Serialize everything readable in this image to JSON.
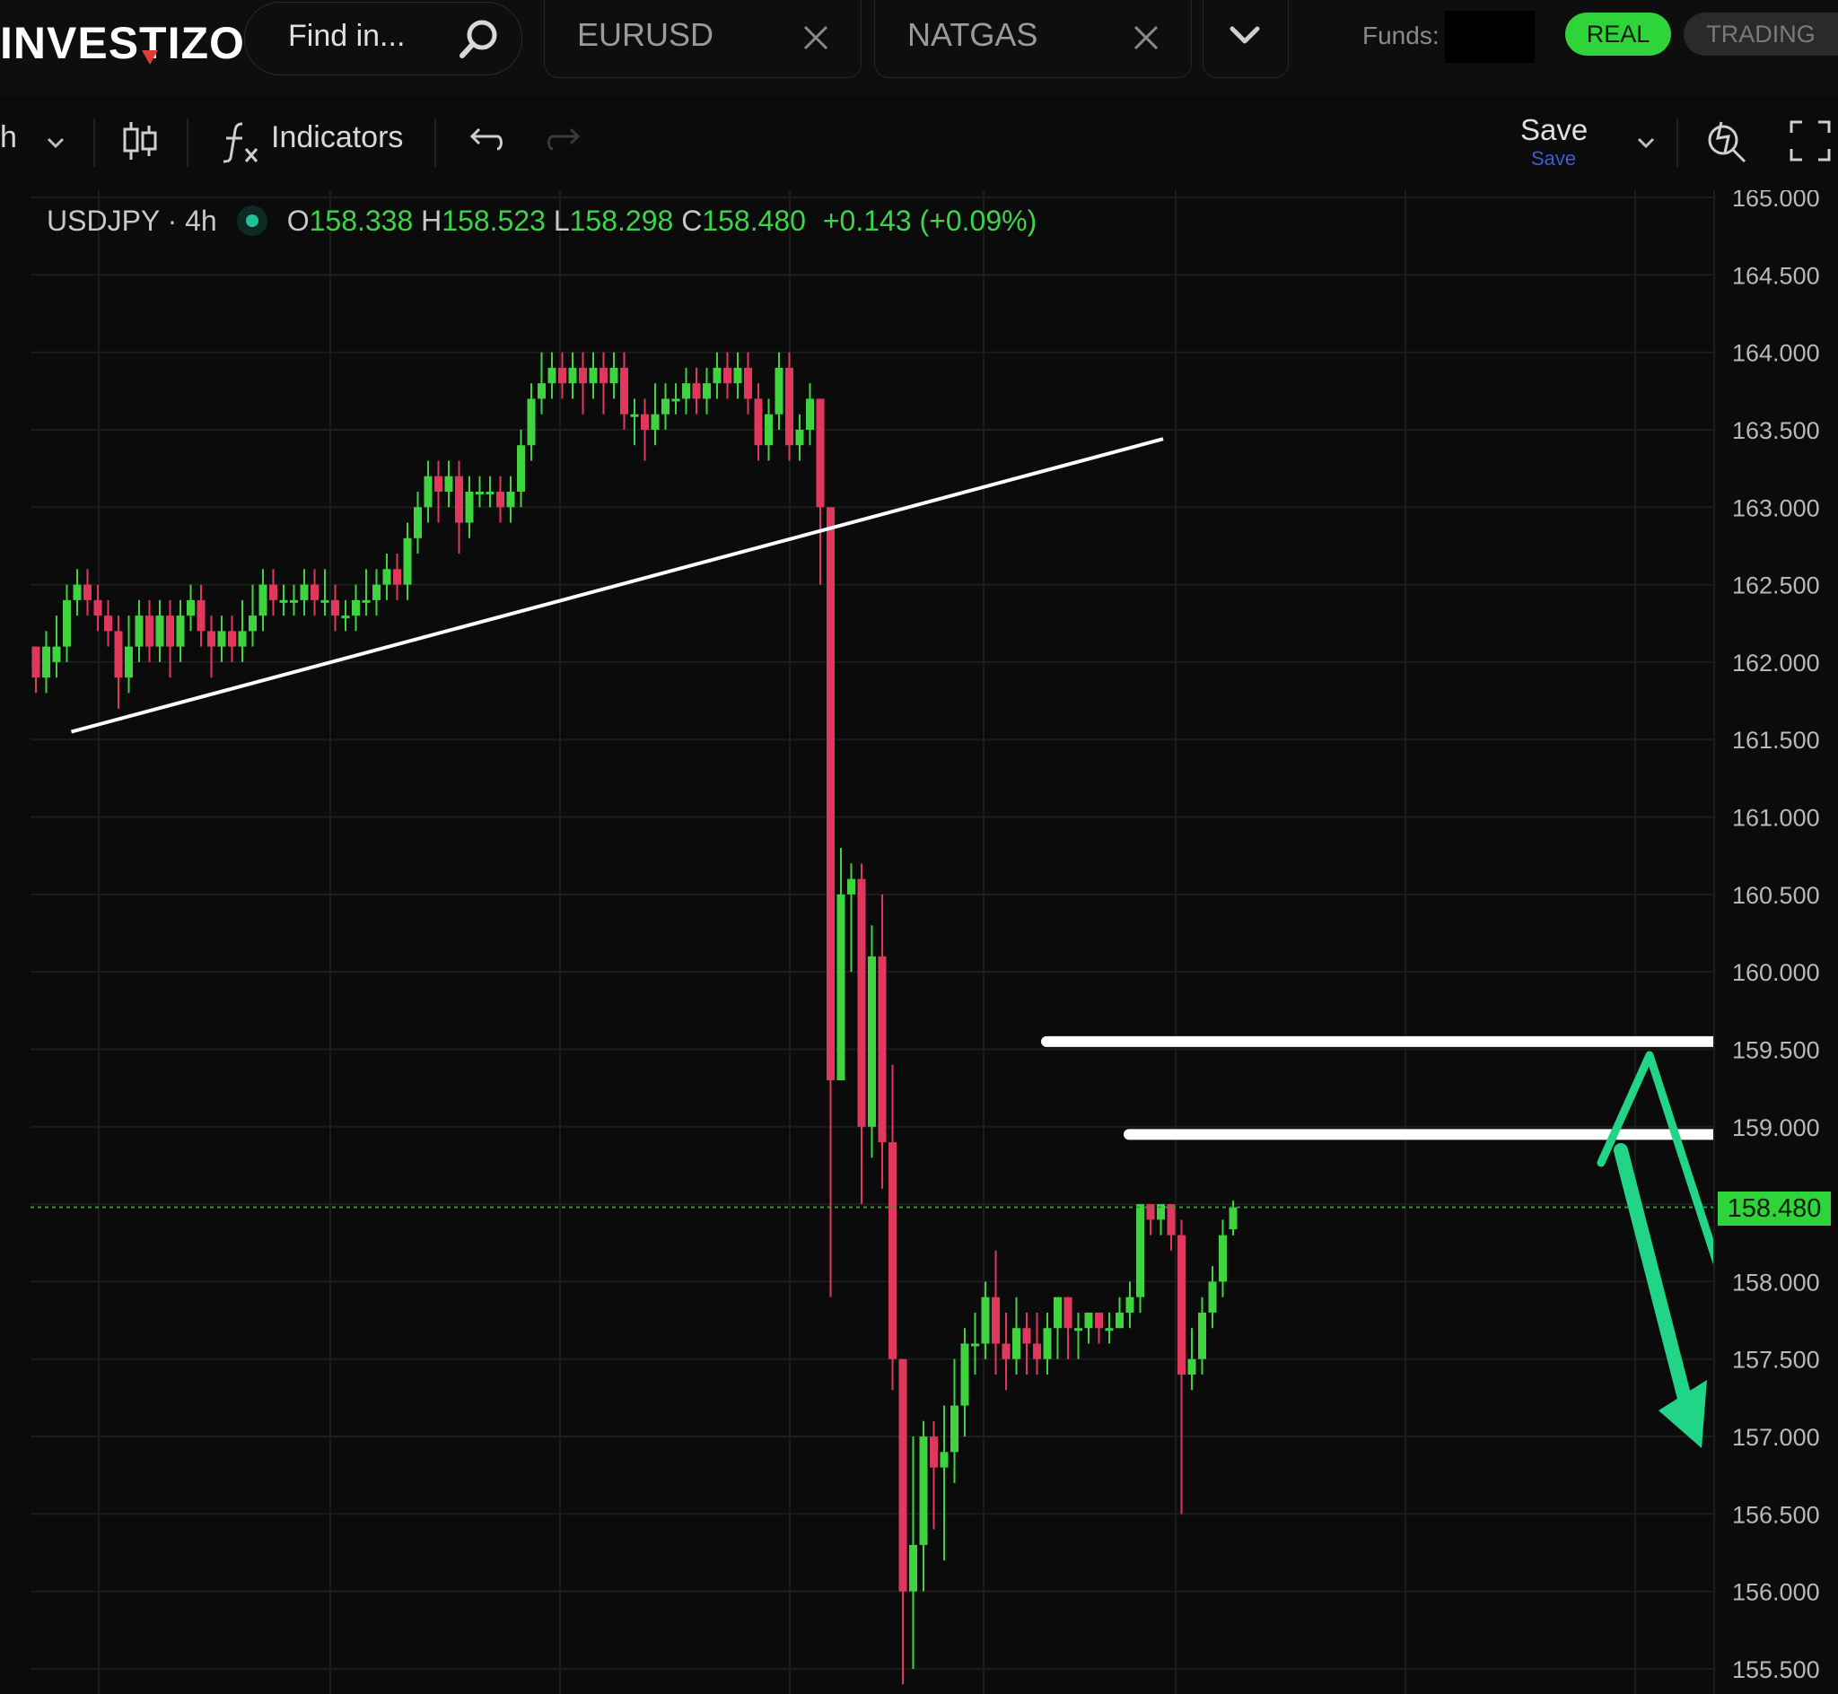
{
  "app": {
    "logo_text": "INVESTIZO",
    "search_placeholder": "Find in...",
    "tabs": [
      {
        "label": "EURUSD"
      },
      {
        "label": "NATGAS"
      }
    ],
    "funds_label": "Funds:",
    "mode_buttons": {
      "real": "REAL",
      "trading": "TRADING"
    }
  },
  "toolbar": {
    "interval_label": "h",
    "indicators_label": "Indicators",
    "save_label": "Save",
    "save_sublabel": "Save"
  },
  "legend": {
    "symbol": "USDJPY · 4h",
    "o_key": "O",
    "o_val": "158.338",
    "h_key": "H",
    "h_val": "158.523",
    "l_key": "L",
    "l_val": "158.298",
    "c_key": "C",
    "c_val": "158.480",
    "change": "+0.143 (+0.09%)"
  },
  "colors": {
    "up": "#3ed33f",
    "down": "#e0385c",
    "accent": "#2fd33a",
    "arrow": "#22d486",
    "grid": "#1c1c1c",
    "background": "#0b0b0b"
  },
  "chart_data": {
    "type": "candlestick",
    "symbol": "USDJPY",
    "timeframe": "4h",
    "ylim": [
      155.5,
      165.0
    ],
    "y_ticks": [
      "165.000",
      "164.500",
      "164.000",
      "163.500",
      "163.000",
      "162.500",
      "162.000",
      "161.500",
      "161.000",
      "160.500",
      "160.000",
      "159.500",
      "159.000",
      "158.500",
      "158.000",
      "157.500",
      "157.000",
      "156.500",
      "156.000",
      "155.500"
    ],
    "y_tick_values": [
      165.0,
      164.5,
      164.0,
      163.5,
      163.0,
      162.5,
      162.0,
      161.5,
      161.0,
      160.5,
      160.0,
      159.5,
      159.0,
      158.5,
      158.0,
      157.5,
      157.0,
      156.5,
      156.0,
      155.5
    ],
    "last_price": "158.480",
    "last_price_value": 158.48,
    "candles": [
      [
        162.1,
        161.9,
        162.1,
        161.8
      ],
      [
        161.9,
        162.1,
        162.2,
        161.8
      ],
      [
        162.0,
        162.1,
        162.3,
        161.9
      ],
      [
        162.1,
        162.4,
        162.5,
        162.0
      ],
      [
        162.4,
        162.5,
        162.6,
        162.3
      ],
      [
        162.5,
        162.4,
        162.6,
        162.3
      ],
      [
        162.4,
        162.3,
        162.5,
        162.2
      ],
      [
        162.3,
        162.2,
        162.4,
        162.1
      ],
      [
        162.2,
        161.9,
        162.3,
        161.7
      ],
      [
        161.9,
        162.1,
        162.3,
        161.8
      ],
      [
        162.1,
        162.3,
        162.4,
        162.0
      ],
      [
        162.3,
        162.1,
        162.4,
        162.0
      ],
      [
        162.1,
        162.3,
        162.4,
        162.0
      ],
      [
        162.3,
        162.1,
        162.4,
        161.9
      ],
      [
        162.1,
        162.3,
        162.4,
        162.0
      ],
      [
        162.3,
        162.4,
        162.5,
        162.2
      ],
      [
        162.4,
        162.2,
        162.5,
        162.1
      ],
      [
        162.2,
        162.1,
        162.3,
        161.9
      ],
      [
        162.1,
        162.2,
        162.3,
        162.0
      ],
      [
        162.2,
        162.1,
        162.3,
        162.0
      ],
      [
        162.1,
        162.2,
        162.4,
        162.0
      ],
      [
        162.2,
        162.3,
        162.5,
        162.1
      ],
      [
        162.3,
        162.5,
        162.6,
        162.2
      ],
      [
        162.5,
        162.4,
        162.6,
        162.3
      ],
      [
        162.4,
        162.4,
        162.5,
        162.3
      ],
      [
        162.4,
        162.4,
        162.5,
        162.3
      ],
      [
        162.4,
        162.5,
        162.6,
        162.3
      ],
      [
        162.5,
        162.4,
        162.6,
        162.3
      ],
      [
        162.4,
        162.4,
        162.6,
        162.3
      ],
      [
        162.4,
        162.3,
        162.5,
        162.2
      ],
      [
        162.3,
        162.3,
        162.4,
        162.2
      ],
      [
        162.3,
        162.4,
        162.5,
        162.2
      ],
      [
        162.4,
        162.4,
        162.6,
        162.3
      ],
      [
        162.4,
        162.5,
        162.6,
        162.3
      ],
      [
        162.5,
        162.6,
        162.7,
        162.4
      ],
      [
        162.6,
        162.5,
        162.7,
        162.4
      ],
      [
        162.5,
        162.8,
        162.9,
        162.4
      ],
      [
        162.8,
        163.0,
        163.1,
        162.7
      ],
      [
        163.0,
        163.2,
        163.3,
        162.9
      ],
      [
        163.2,
        163.1,
        163.3,
        162.9
      ],
      [
        163.1,
        163.2,
        163.3,
        163.0
      ],
      [
        163.2,
        162.9,
        163.3,
        162.7
      ],
      [
        162.9,
        163.1,
        163.2,
        162.8
      ],
      [
        163.1,
        163.1,
        163.2,
        163.0
      ],
      [
        163.1,
        163.1,
        163.2,
        163.0
      ],
      [
        163.1,
        163.0,
        163.2,
        162.9
      ],
      [
        163.0,
        163.1,
        163.2,
        162.9
      ],
      [
        163.1,
        163.4,
        163.5,
        163.0
      ],
      [
        163.4,
        163.7,
        163.8,
        163.3
      ],
      [
        163.7,
        163.8,
        164.0,
        163.6
      ],
      [
        163.8,
        163.9,
        164.0,
        163.7
      ],
      [
        163.9,
        163.8,
        164.0,
        163.7
      ],
      [
        163.8,
        163.9,
        164.0,
        163.7
      ],
      [
        163.9,
        163.8,
        164.0,
        163.6
      ],
      [
        163.8,
        163.9,
        164.0,
        163.7
      ],
      [
        163.9,
        163.8,
        164.0,
        163.6
      ],
      [
        163.8,
        163.9,
        164.0,
        163.7
      ],
      [
        163.9,
        163.6,
        164.0,
        163.5
      ],
      [
        163.6,
        163.6,
        163.7,
        163.4
      ],
      [
        163.6,
        163.5,
        163.7,
        163.3
      ],
      [
        163.5,
        163.6,
        163.8,
        163.4
      ],
      [
        163.6,
        163.7,
        163.8,
        163.5
      ],
      [
        163.7,
        163.7,
        163.8,
        163.6
      ],
      [
        163.7,
        163.8,
        163.9,
        163.6
      ],
      [
        163.8,
        163.7,
        163.9,
        163.6
      ],
      [
        163.7,
        163.8,
        163.9,
        163.6
      ],
      [
        163.8,
        163.9,
        164.0,
        163.7
      ],
      [
        163.9,
        163.8,
        164.0,
        163.7
      ],
      [
        163.8,
        163.9,
        164.0,
        163.7
      ],
      [
        163.9,
        163.7,
        164.0,
        163.6
      ],
      [
        163.7,
        163.4,
        163.8,
        163.3
      ],
      [
        163.4,
        163.6,
        163.7,
        163.3
      ],
      [
        163.6,
        163.9,
        164.0,
        163.5
      ],
      [
        163.9,
        163.4,
        164.0,
        163.3
      ],
      [
        163.4,
        163.5,
        163.6,
        163.3
      ],
      [
        163.5,
        163.7,
        163.8,
        163.4
      ],
      [
        163.7,
        163.0,
        163.7,
        162.5
      ],
      [
        163.0,
        159.3,
        163.0,
        157.9
      ],
      [
        159.3,
        160.5,
        160.8,
        159.4
      ],
      [
        160.5,
        160.6,
        160.7,
        160.0
      ],
      [
        160.6,
        159.0,
        160.7,
        158.5
      ],
      [
        159.0,
        160.1,
        160.3,
        158.8
      ],
      [
        160.1,
        158.9,
        160.5,
        158.6
      ],
      [
        158.9,
        157.5,
        159.4,
        157.3
      ],
      [
        157.5,
        156.0,
        157.5,
        155.4
      ],
      [
        156.0,
        156.3,
        157.0,
        155.5
      ],
      [
        156.3,
        157.0,
        157.1,
        156.0
      ],
      [
        157.0,
        156.8,
        157.1,
        156.4
      ],
      [
        156.8,
        156.9,
        157.2,
        156.2
      ],
      [
        156.9,
        157.2,
        157.5,
        156.7
      ],
      [
        157.2,
        157.6,
        157.7,
        157.0
      ],
      [
        157.6,
        157.6,
        157.8,
        157.4
      ],
      [
        157.6,
        157.9,
        158.0,
        157.5
      ],
      [
        157.9,
        157.6,
        158.2,
        157.4
      ],
      [
        157.6,
        157.5,
        157.8,
        157.3
      ],
      [
        157.5,
        157.7,
        157.9,
        157.4
      ],
      [
        157.7,
        157.6,
        157.8,
        157.4
      ],
      [
        157.6,
        157.5,
        157.8,
        157.4
      ],
      [
        157.5,
        157.7,
        157.8,
        157.4
      ],
      [
        157.7,
        157.9,
        157.9,
        157.5
      ],
      [
        157.9,
        157.7,
        157.9,
        157.5
      ],
      [
        157.7,
        157.7,
        157.8,
        157.5
      ],
      [
        157.7,
        157.8,
        157.8,
        157.6
      ],
      [
        157.8,
        157.7,
        157.8,
        157.6
      ],
      [
        157.7,
        157.7,
        157.8,
        157.6
      ],
      [
        157.7,
        157.8,
        157.9,
        157.7
      ],
      [
        157.8,
        157.9,
        158.0,
        157.7
      ],
      [
        157.9,
        158.5,
        158.5,
        157.8
      ],
      [
        158.5,
        158.4,
        158.5,
        158.3
      ],
      [
        158.4,
        158.5,
        158.5,
        158.3
      ],
      [
        158.5,
        158.3,
        158.5,
        158.2
      ],
      [
        158.3,
        157.4,
        158.4,
        156.5
      ],
      [
        157.4,
        157.5,
        157.7,
        157.3
      ],
      [
        157.5,
        157.8,
        157.9,
        157.4
      ],
      [
        157.8,
        158.0,
        158.1,
        157.7
      ],
      [
        158.0,
        158.3,
        158.4,
        157.9
      ],
      [
        158.338,
        158.48,
        158.523,
        158.298
      ]
    ],
    "trendline": {
      "from": [
        1,
        161.55
      ],
      "to": [
        84,
        163.4
      ]
    },
    "resistance_levels": [
      {
        "price": 159.55,
        "from_index": 76,
        "to_index": 131
      },
      {
        "price": 158.95,
        "from_index": 84,
        "to_index": 131
      }
    ],
    "annotations": "Hand-drawn green arrows projecting a move up toward the resistance zone then down toward ~157.0"
  }
}
